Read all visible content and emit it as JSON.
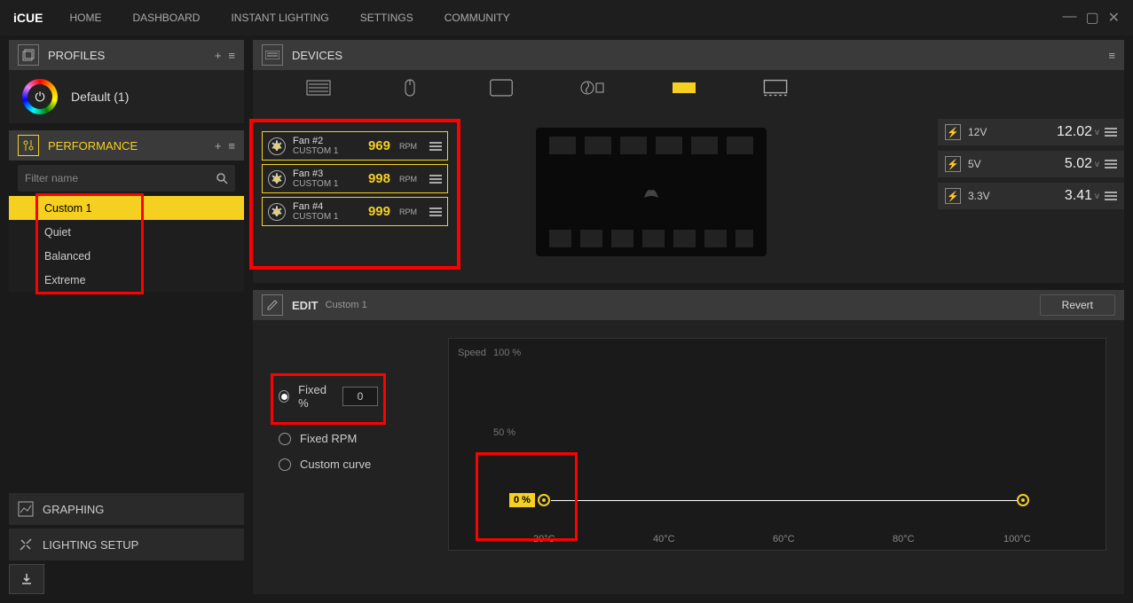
{
  "app": {
    "name": "iCUE"
  },
  "nav": {
    "home": "HOME",
    "dashboard": "DASHBOARD",
    "instant": "INSTANT LIGHTING",
    "settings": "SETTINGS",
    "community": "COMMUNITY"
  },
  "profiles": {
    "title": "PROFILES",
    "default": "Default (1)"
  },
  "performance": {
    "title": "PERFORMANCE",
    "filter_placeholder": "Filter name",
    "items": [
      "Custom 1",
      "Quiet",
      "Balanced",
      "Extreme"
    ],
    "selected_index": 0
  },
  "sidebar_bottom": {
    "graphing": "GRAPHING",
    "lighting": "LIGHTING SETUP"
  },
  "devices": {
    "title": "DEVICES"
  },
  "fans": [
    {
      "name": "Fan #2",
      "profile": "CUSTOM 1",
      "rpm": "969",
      "unit": "RPM"
    },
    {
      "name": "Fan #3",
      "profile": "CUSTOM 1",
      "rpm": "998",
      "unit": "RPM"
    },
    {
      "name": "Fan #4",
      "profile": "CUSTOM 1",
      "rpm": "999",
      "unit": "RPM"
    }
  ],
  "voltages": [
    {
      "label": "12V",
      "value": "12.02",
      "unit": "v"
    },
    {
      "label": "5V",
      "value": "5.02",
      "unit": "v"
    },
    {
      "label": "3.3V",
      "value": "3.41",
      "unit": "v"
    }
  ],
  "edit": {
    "title": "EDIT",
    "subtitle": "Custom 1",
    "revert": "Revert",
    "fixed_pct": "Fixed %",
    "fixed_pct_val": "0",
    "fixed_rpm": "Fixed RPM",
    "custom_curve": "Custom curve"
  },
  "chart_data": {
    "type": "line",
    "title": "",
    "ylabel": "Speed",
    "xlabel": "",
    "x_unit": "°C",
    "y_unit": "%",
    "x_ticks": [
      "20°C",
      "40°C",
      "60°C",
      "80°C",
      "100°C"
    ],
    "y_ticks": [
      "100 %",
      "50 %"
    ],
    "xlim": [
      20,
      100
    ],
    "ylim": [
      0,
      100
    ],
    "series": [
      {
        "name": "Fixed",
        "x": [
          20,
          100
        ],
        "y": [
          0,
          0
        ]
      }
    ],
    "badge": "0 %",
    "point_highlight": {
      "x": 20,
      "y": 0
    }
  }
}
